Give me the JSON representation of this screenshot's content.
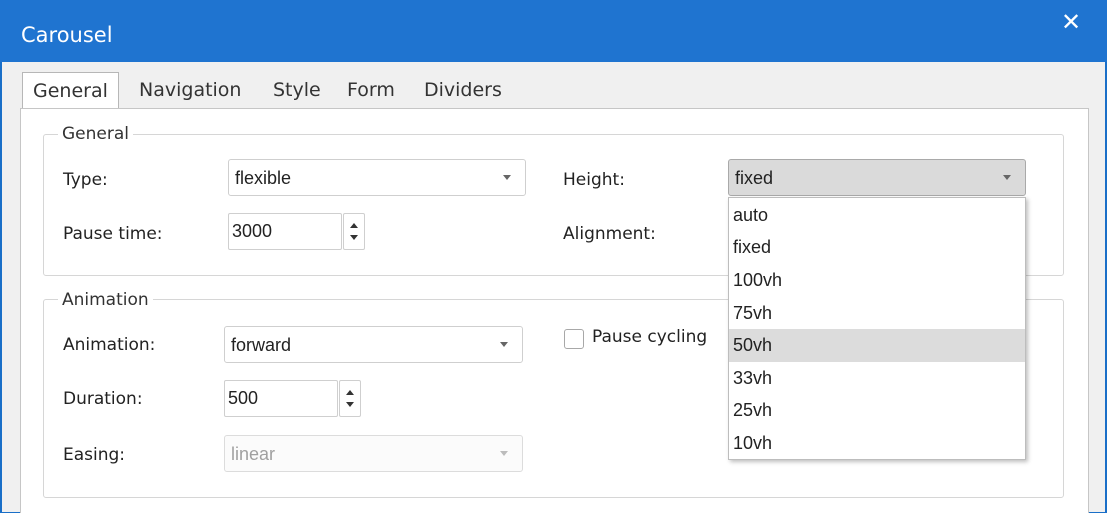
{
  "window": {
    "title": "Carousel"
  },
  "tabs": [
    {
      "label": "General"
    },
    {
      "label": "Navigation"
    },
    {
      "label": "Style"
    },
    {
      "label": "Form"
    },
    {
      "label": "Dividers"
    }
  ],
  "general": {
    "legend": "General",
    "type_label": "Type:",
    "type_value": "flexible",
    "pause_label": "Pause time:",
    "pause_value": "3000",
    "height_label": "Height:",
    "height_value": "fixed",
    "alignment_label": "Alignment:"
  },
  "animation": {
    "legend": "Animation",
    "animation_label": "Animation:",
    "animation_value": "forward",
    "duration_label": "Duration:",
    "duration_value": "500",
    "easing_label": "Easing:",
    "easing_value": "linear",
    "pause_cycling_label": "Pause cycling"
  },
  "height_dropdown": {
    "options": [
      "auto",
      "fixed",
      "100vh",
      "75vh",
      "50vh",
      "33vh",
      "25vh",
      "10vh"
    ],
    "highlighted": "50vh"
  },
  "icons": {
    "close": "close-icon"
  }
}
